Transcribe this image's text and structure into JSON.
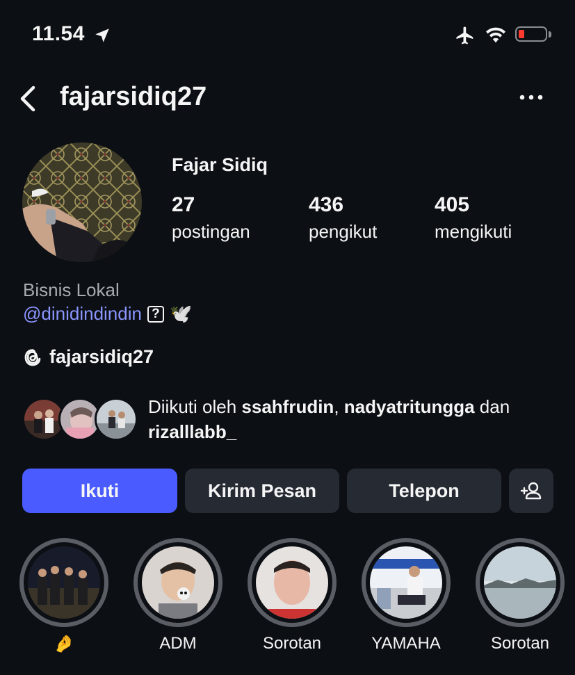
{
  "status_bar": {
    "time": "11.54"
  },
  "header": {
    "username": "fajarsidiq27"
  },
  "profile": {
    "display_name": "Fajar Sidiq",
    "stats": [
      {
        "value": "27",
        "label": "postingan"
      },
      {
        "value": "436",
        "label": "pengikut"
      },
      {
        "value": "405",
        "label": "mengikuti"
      }
    ],
    "category": "Bisnis Lokal",
    "mention": "@dinidindindin",
    "mention_glyph": "?",
    "mention_emoji": "🕊️",
    "threads_handle": "fajarsidiq27"
  },
  "followed_by": {
    "prefix": "Diikuti oleh ",
    "user1": "ssahfrudin",
    "sep": ", ",
    "user2": "nadyatritungga",
    "conj": " dan ",
    "user3": "rizalllabb_"
  },
  "actions": {
    "follow": "Ikuti",
    "message": "Kirim Pesan",
    "call": "Telepon"
  },
  "highlights": [
    {
      "label": "🤌"
    },
    {
      "label": "ADM"
    },
    {
      "label": "Sorotan"
    },
    {
      "label": "YAMAHA"
    },
    {
      "label": "Sorotan"
    }
  ],
  "colors": {
    "background": "#0c0f14",
    "primary_button": "#4a5cff",
    "secondary_button": "#262a33",
    "mention": "#8b95ff"
  }
}
